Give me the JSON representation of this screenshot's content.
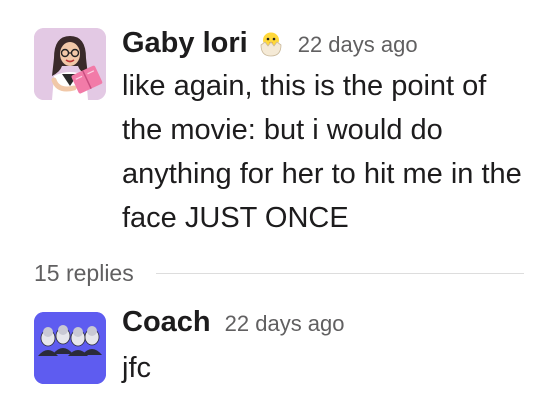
{
  "parent_message": {
    "author": "Gaby lori",
    "status_emoji": "hatching-chick-icon",
    "timestamp": "22 days ago",
    "text": "like again, this is the point of the movie: but i would do anything for her to hit me in the face JUST ONCE"
  },
  "thread": {
    "reply_count_label": "15 replies"
  },
  "reply_message": {
    "author": "Coach",
    "timestamp": "22 days ago",
    "text": "jfc"
  },
  "colors": {
    "text_primary": "#1d1c1d",
    "text_secondary": "#616061",
    "divider": "#dddddd",
    "coach_avatar_bg": "#5e5cf0",
    "gaby_avatar_bg": "#e3c9e4"
  }
}
